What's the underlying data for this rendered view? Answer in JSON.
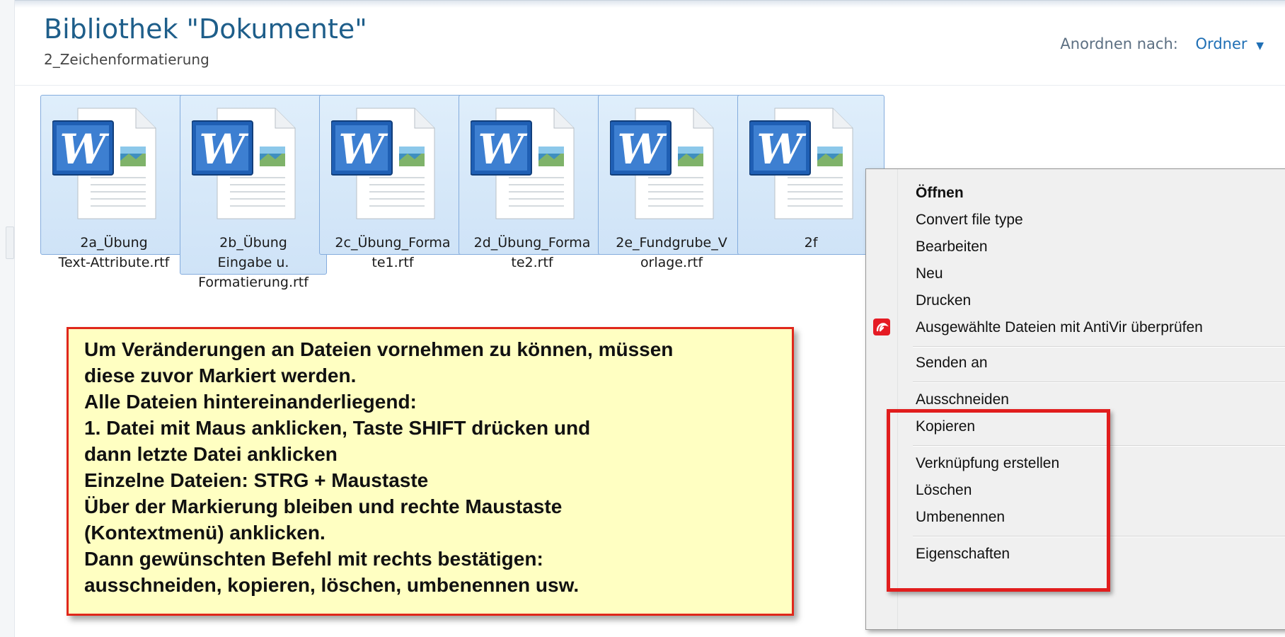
{
  "library": {
    "title": "Bibliothek \"Dokumente\"",
    "subtitle": "2_Zeichenformatierung"
  },
  "arrange": {
    "label": "Anordnen nach:",
    "value": "Ordner",
    "caret": "▼"
  },
  "icons": {
    "document": "word-document-icon",
    "antivir": "antivir-umbrella-icon"
  },
  "colors": {
    "title": "#1e5e8a",
    "link": "#1f6fb5",
    "selection_fill": "#d4e6f9",
    "selection_border": "#84acdd",
    "note_fill": "#ffffc2",
    "highlight_red": "#e11d1d"
  },
  "files": [
    {
      "name_lines": [
        "2a_Übung",
        "Text-Attribute.rtf"
      ]
    },
    {
      "name_lines": [
        "2b_Übung",
        "Eingabe u.",
        "Formatierung.rtf"
      ]
    },
    {
      "name_lines": [
        "2c_Übung_Forma",
        "te1.rtf"
      ]
    },
    {
      "name_lines": [
        "2d_Übung_Forma",
        "te2.rtf"
      ]
    },
    {
      "name_lines": [
        "2e_Fundgrube_V",
        "orlage.rtf"
      ]
    },
    {
      "name_lines": [
        "2f",
        ""
      ]
    }
  ],
  "note": {
    "lines": [
      "Um Veränderungen an Dateien vornehmen zu können, müssen",
      "diese zuvor Markiert werden.",
      "Alle Dateien hintereinanderliegend:",
      "1. Datei mit Maus anklicken, Taste SHIFT drücken und",
      "dann letzte Datei anklicken",
      "Einzelne Dateien: STRG + Maustaste",
      "Über der Markierung bleiben und rechte Maustaste",
      "(Kontextmenü) anklicken.",
      "Dann gewünschten Befehl mit rechts bestätigen:",
      "ausschneiden, kopieren, löschen, umbenennen usw."
    ]
  },
  "context_menu": {
    "items": [
      {
        "label": "Öffnen",
        "bold": true
      },
      {
        "label": "Convert file type"
      },
      {
        "label": "Bearbeiten"
      },
      {
        "label": "Neu"
      },
      {
        "label": "Drucken"
      },
      {
        "label": "Ausgewählte Dateien mit AntiVir überprüfen",
        "icon": "antivir-umbrella-icon"
      },
      {
        "label": "Senden an"
      },
      {
        "label": "Ausschneiden"
      },
      {
        "label": "Kopieren"
      },
      {
        "label": "Verknüpfung erstellen"
      },
      {
        "label": "Löschen"
      },
      {
        "label": "Umbenennen"
      },
      {
        "label": "Eigenschaften"
      }
    ],
    "highlighted": [
      "Ausschneiden",
      "Kopieren",
      "Verknüpfung erstellen",
      "Löschen",
      "Umbenennen"
    ]
  }
}
